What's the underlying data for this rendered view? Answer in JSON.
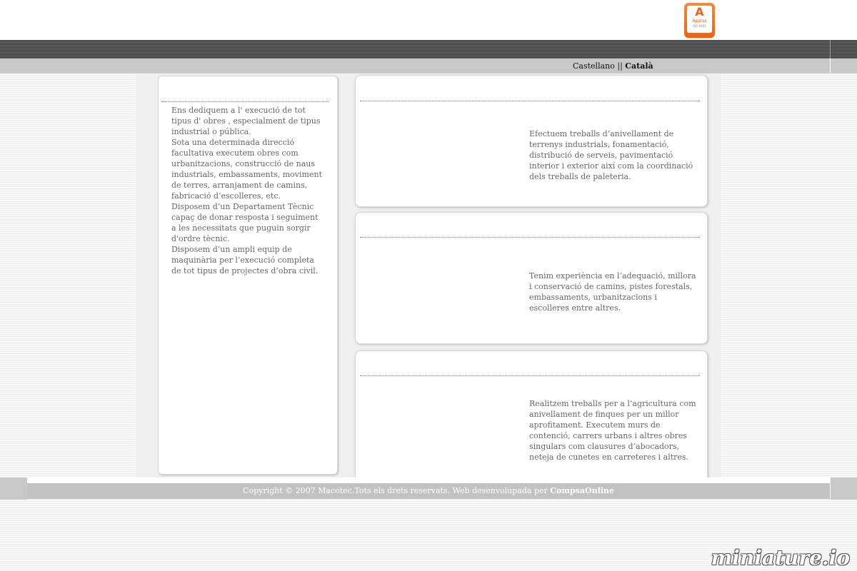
{
  "header": {
    "logo": {
      "letter": "A",
      "brand": "Applus",
      "subtitle": "ISO 9001"
    }
  },
  "language": {
    "castellano": "Castellano",
    "separator": "||",
    "catala": "Català"
  },
  "intro": {
    "paragraphs": [
      "Ens dediquem a l' execució de tot tipus d' obres , especialment de tipus industrial o pública.",
      "Sota una determinada direcció facultativa executem obres com urbanitzacions, construcció de naus industrials, embassaments, moviment de terres, arranjament de camins, fabricació d’escolleres, etc.",
      "Disposem d’un Departament Tècnic capaç de donar resposta i seguiment a les necessitats que puguin sorgir d'ordre tècnic.",
      "Disposem d’un ampli equip de maquinària per l’execució completa de tot tipus de projectes d’obra civil."
    ]
  },
  "cards": [
    {
      "text": "Efectuem treballs d’anivellament de terrenys industrials, fonamentació, distribució de serveis, pavimentació interior i exterior així com la coordinació dels treballs de paleteria."
    },
    {
      "text": "Tenim experiència en l’adequació, millora i conservació de camins, pistes forestals, embassaments, urbanitzacions i escolleres entre altres."
    },
    {
      "text": "Realitzem treballs per a l’agricultura com anivellament de finques per un millor aprofitament. Executem murs de contenció, carrers urbans i altres obres singulars com clausures d’abocadors, neteja de cunetes en carreteres i altres."
    }
  ],
  "footer": {
    "copyright": "Copyright © 2007 Macotec.Tots els drets reservats. Web desenvolupada per ",
    "credit": "CompsaOnline"
  },
  "watermark": "miniature.io"
}
